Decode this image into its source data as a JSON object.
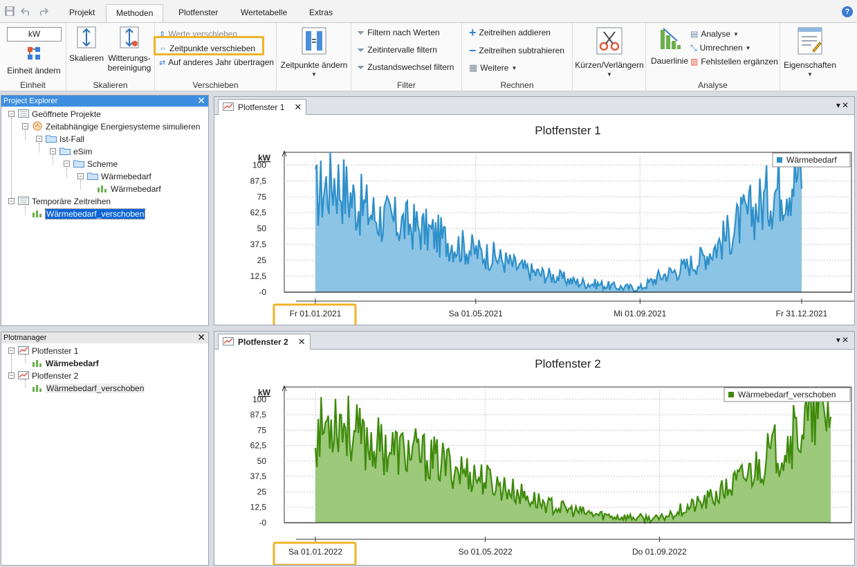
{
  "toolbar": {
    "tabs": [
      "Projekt",
      "Methoden",
      "Plotfenster",
      "Wertetabelle",
      "Extras"
    ],
    "active_tab": "Methoden",
    "help": "?"
  },
  "ribbon": {
    "einheit": {
      "unit_value": "kW",
      "change_label": "Einheit ändern",
      "group": "Einheit"
    },
    "skalieren": {
      "skalieren_label": "Skalieren",
      "witterung_label_1": "Witterungs-",
      "witterung_label_2": "bereinigung",
      "group": "Skalieren"
    },
    "verschieben": {
      "werte": "Werte verschieben",
      "zeitpunkte": "Zeitpunkte verschieben",
      "jahr": "Auf anderes Jahr übertragen",
      "group": "Verschieben"
    },
    "zeitpunkte_aendern": "Zeitpunkte ändern",
    "filter": {
      "werte": "Filtern nach Werten",
      "intervalle": "Zeitintervalle filtern",
      "zustand": "Zustandswechsel filtern",
      "group": "Filter"
    },
    "rechnen": {
      "addieren": "Zeitreihen addieren",
      "subtrahieren": "Zeitreihen subtrahieren",
      "weitere": "Weitere",
      "group": "Rechnen"
    },
    "kuerzen": "Kürzen/Verlängern",
    "analyse": {
      "dauerlinie": "Dauerlinie",
      "analyse": "Analyse",
      "umrechnen": "Umrechnen",
      "fehlstellen": "Fehlstellen ergänzen",
      "group": "Analyse"
    },
    "eigenschaften": "Eigenschaften"
  },
  "explorer": {
    "title": "Project Explorer",
    "items": [
      "Geöffnete Projekte",
      "Zeitabhängige Energiesysteme simulieren",
      "Ist-Fall",
      "eSim",
      "Scheme",
      "Wärmebedarf",
      "Wärmebedarf",
      "Temporäre Zeitreihen",
      "Wärmebedarf_verschoben"
    ]
  },
  "plotmanager": {
    "title": "Plotmanager",
    "items": [
      "Plotfenster 1",
      "Wärmebedarf",
      "Plotfenster 2",
      "Wärmebedarf_verschoben"
    ]
  },
  "plot1": {
    "tab": "Plotfenster 1"
  },
  "plot2": {
    "tab": "Plotfenster 2"
  },
  "colors": {
    "series1": "#2e8fc9",
    "series1_fill": "#8cc4e6",
    "series2": "#3f8a0c",
    "series2_fill": "#9cc97a",
    "highlight": "#f0b429"
  },
  "chart_data": [
    {
      "type": "area",
      "title": "Plotfenster 1",
      "ylabel": "kW",
      "yticks": [
        "100",
        "87,5",
        "75",
        "62,5",
        "50",
        "37,5",
        "25",
        "12,5",
        "-0"
      ],
      "ylim": [
        0,
        110
      ],
      "xticks": [
        "Fr 01.01.2021",
        "Sa 01.05.2021",
        "Mi 01.09.2021",
        "Fr 31.12.2021"
      ],
      "x_range": [
        "2021-01-01",
        "2021-12-31"
      ],
      "legend": "top-right",
      "grid": true,
      "series": [
        {
          "name": "Wärmebedarf",
          "x": [
            "2021-01-01",
            "2021-01-15",
            "2021-02-01",
            "2021-02-15",
            "2021-03-01",
            "2021-03-15",
            "2021-04-01",
            "2021-04-15",
            "2021-05-01",
            "2021-05-15",
            "2021-06-01",
            "2021-06-15",
            "2021-07-01",
            "2021-07-15",
            "2021-08-01",
            "2021-08-15",
            "2021-09-01",
            "2021-09-15",
            "2021-10-01",
            "2021-10-15",
            "2021-11-01",
            "2021-11-15",
            "2021-12-01",
            "2021-12-15",
            "2021-12-31"
          ],
          "values": [
            75,
            90,
            70,
            60,
            55,
            52,
            45,
            38,
            32,
            28,
            20,
            15,
            12,
            8,
            6,
            4,
            3,
            12,
            18,
            25,
            40,
            55,
            70,
            85,
            95
          ]
        }
      ]
    },
    {
      "type": "area",
      "title": "Plotfenster 2",
      "ylabel": "kW",
      "yticks": [
        "100",
        "87,5",
        "75",
        "62,5",
        "50",
        "37,5",
        "25",
        "12,5",
        "-0"
      ],
      "ylim": [
        0,
        110
      ],
      "xticks": [
        "Sa 01.01.2022",
        "So 01.05.2022",
        "Do 01.09.2022"
      ],
      "x_range": [
        "2022-01-01",
        "2022-12-31"
      ],
      "legend": "top-right",
      "grid": true,
      "series": [
        {
          "name": "Wärmebedarf_verschoben",
          "x": [
            "2022-01-01",
            "2022-01-15",
            "2022-02-01",
            "2022-02-15",
            "2022-03-01",
            "2022-03-15",
            "2022-04-01",
            "2022-04-15",
            "2022-05-01",
            "2022-05-15",
            "2022-06-01",
            "2022-06-15",
            "2022-07-01",
            "2022-07-15",
            "2022-08-01",
            "2022-08-15",
            "2022-09-01",
            "2022-09-15",
            "2022-10-01",
            "2022-10-15",
            "2022-11-01",
            "2022-11-15",
            "2022-12-01",
            "2022-12-15",
            "2022-12-31"
          ],
          "values": [
            70,
            88,
            68,
            62,
            58,
            55,
            48,
            42,
            35,
            28,
            20,
            14,
            10,
            7,
            5,
            4,
            3,
            10,
            16,
            24,
            38,
            52,
            66,
            82,
            92
          ]
        }
      ]
    }
  ]
}
